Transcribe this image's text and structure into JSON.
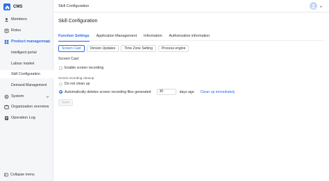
{
  "app": {
    "logo_text": "CMS"
  },
  "sidebar": {
    "items": [
      {
        "label": "Members",
        "icon": "user-icon"
      },
      {
        "label": "Roles",
        "icon": "badge-icon"
      },
      {
        "label": "Product management",
        "icon": "grid-icon"
      },
      {
        "label": "System",
        "icon": "gear-icon"
      },
      {
        "label": "Organization overview",
        "icon": "org-icon"
      },
      {
        "label": "Operation Log",
        "icon": "log-icon"
      }
    ],
    "sub_items": [
      {
        "label": "Intelligent portal"
      },
      {
        "label": "Labour market"
      },
      {
        "label": "Skill Configuration"
      },
      {
        "label": "Demand Management"
      }
    ],
    "collapse_label": "Collapse menu"
  },
  "topbar": {
    "breadcrumb": "Skill Configuration"
  },
  "main": {
    "title": "Skill Configuration",
    "tabs": [
      {
        "label": "Function Settings"
      },
      {
        "label": "Application Management"
      },
      {
        "label": "Information"
      },
      {
        "label": "Authorization information"
      }
    ],
    "subtabs": [
      {
        "label": "Screen Cast"
      },
      {
        "label": "Version Updates"
      },
      {
        "label": "Time Zone Setting"
      },
      {
        "label": "Process engine"
      }
    ],
    "section_title": "Screen Cast",
    "enable_label": "Enable screen recording",
    "enable_checked": false,
    "cleanup_heading": "Screen recording cleanup",
    "radio_no_clean": "Do not clean up",
    "radio_auto": "Automatically deletes screen recording files generated",
    "auto_selected": true,
    "days_value": "30",
    "days_label": "days ago",
    "clean_now": "Clean up immediately",
    "save_label": "Save"
  },
  "colors": {
    "accent": "#2b6de8"
  }
}
